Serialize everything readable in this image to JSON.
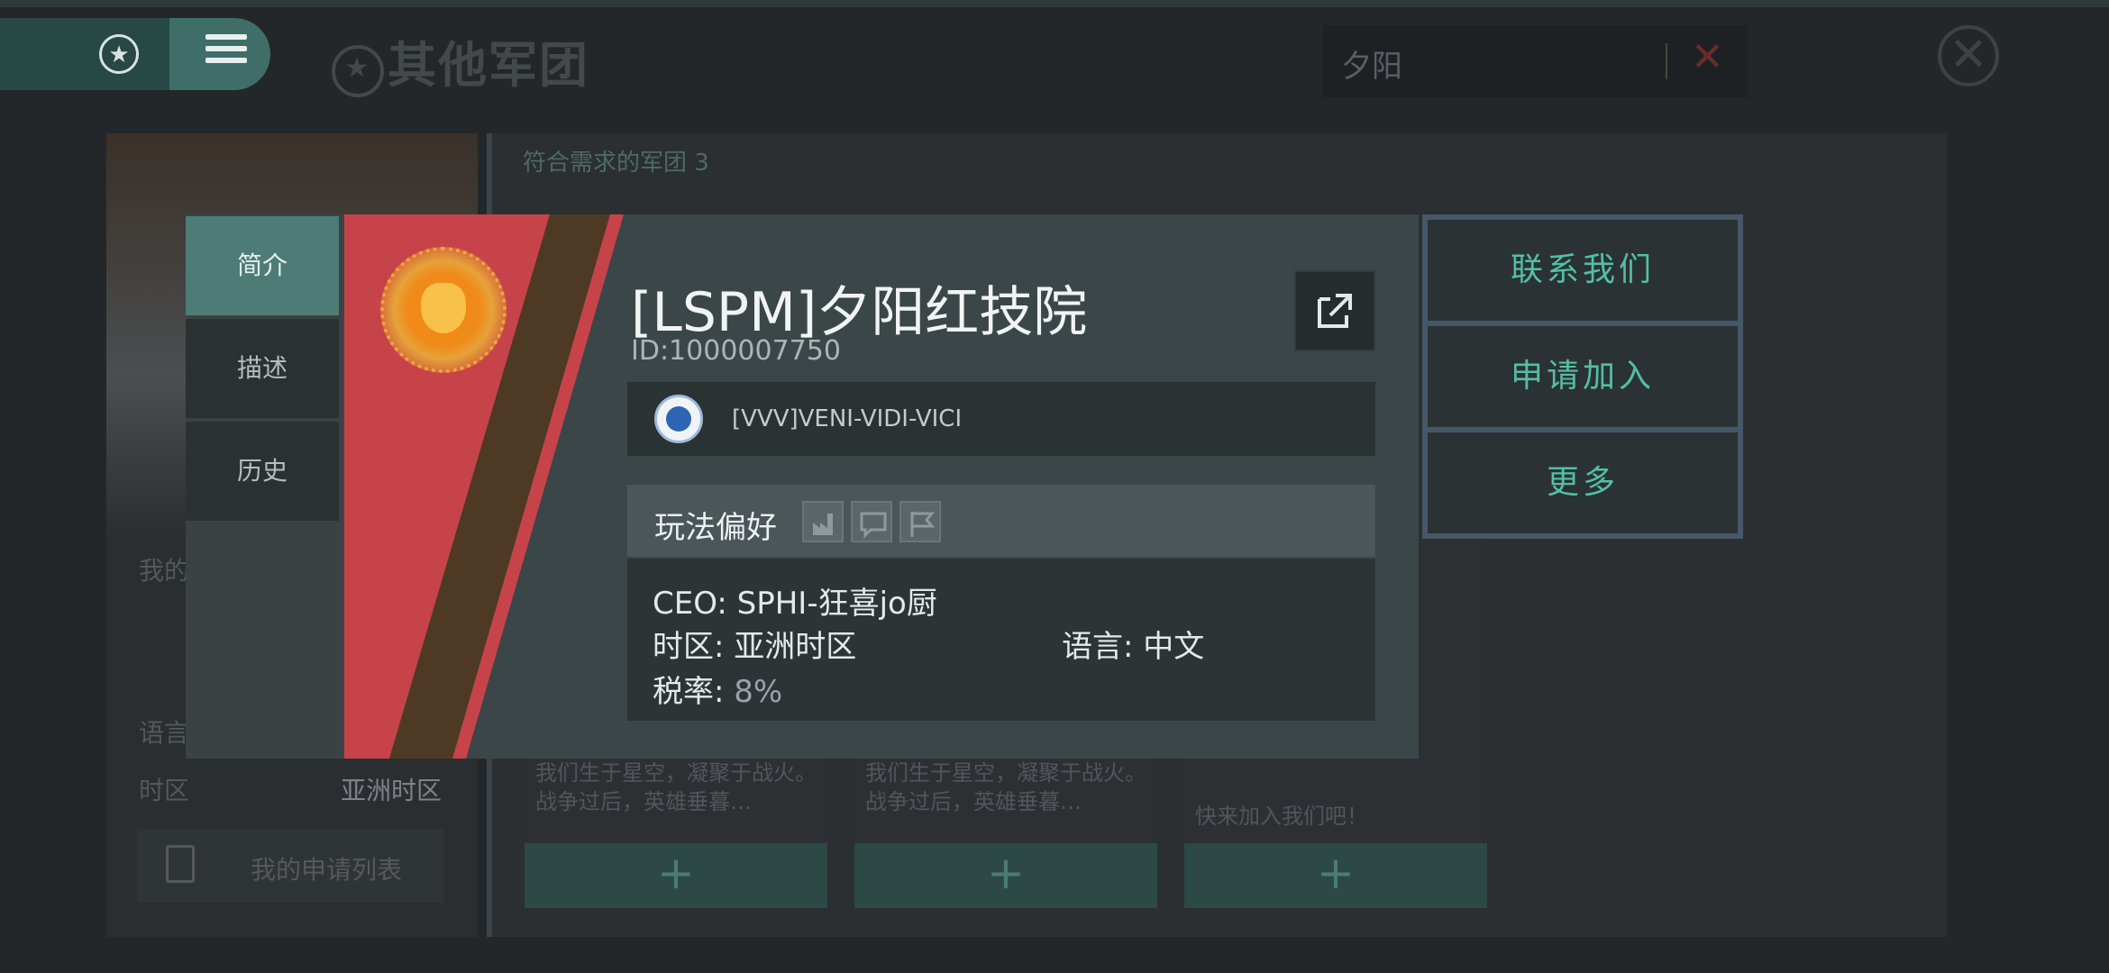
{
  "header": {
    "title": "其他军团",
    "search_value": "夕阳",
    "clear_icon": "close-x-icon",
    "close_icon": "close-circle-icon"
  },
  "background": {
    "count_label": "符合需求的军团  3",
    "left_labels": {
      "my": "我的",
      "language": "语言",
      "timezone_label": "时区",
      "timezone_value": "亚洲时区"
    },
    "my_application_list": "我的申请列表",
    "cards": [
      {
        "text": "我们生于星空，凝聚于战火。战争过后，英雄垂暮…"
      },
      {
        "text": "我们生于星空，凝聚于战火。战争过后，英雄垂暮…"
      },
      {
        "text": "快来加入我们吧！"
      }
    ],
    "add_icon": "plus-icon"
  },
  "modal": {
    "tabs": [
      {
        "label": "简介",
        "active": true
      },
      {
        "label": "描述",
        "active": false
      },
      {
        "label": "历史",
        "active": false
      }
    ],
    "corp_name": "[LSPM]夕阳红技院",
    "corp_id": "ID:1000007750",
    "alliance_name": "[VVV]VENI-VIDI-VICI",
    "play_preference_label": "玩法偏好",
    "preference_icons": [
      "factory-icon",
      "chat-icon",
      "flag-icon"
    ],
    "ceo": "CEO: SPHI-狂喜jo厨",
    "timezone": "时区: 亚洲时区",
    "language": "语言: 中文",
    "tax_label": "税率:",
    "tax_value": "8%",
    "banner_colors": {
      "red": "#c7434a",
      "brown": "#4e3a24",
      "emblem": "#f08a18"
    }
  },
  "actions": [
    {
      "label": "联系我们"
    },
    {
      "label": "申请加入"
    },
    {
      "label": "更多"
    }
  ]
}
